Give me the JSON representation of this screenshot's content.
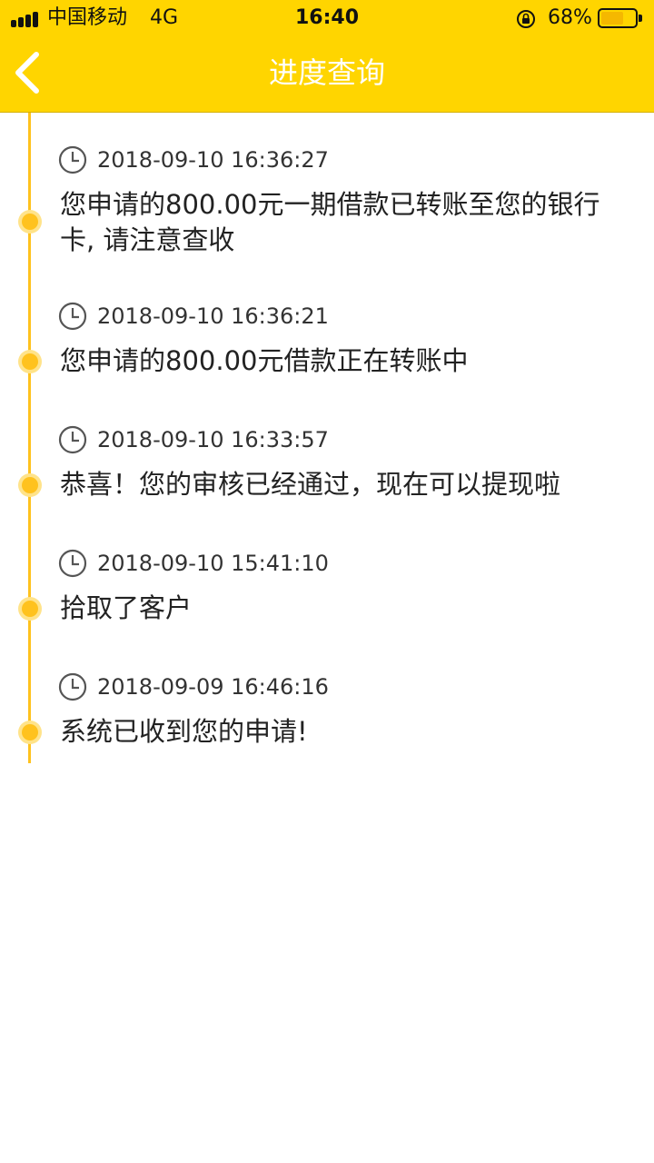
{
  "status_bar": {
    "carrier": "中国移动",
    "network": "4G",
    "time": "16:40",
    "battery": "68%",
    "battery_level": 0.68
  },
  "header": {
    "title": "进度查询",
    "back_icon": "chevron-left-icon"
  },
  "events": [
    {
      "time": "2018-09-10 16:36:27",
      "text": "您申请的800.00元一期借款已转账至您的银行卡, 请注意查收"
    },
    {
      "time": "2018-09-10 16:36:21",
      "text": "您申请的800.00元借款正在转账中"
    },
    {
      "time": "2018-09-10 16:33:57",
      "text": "恭喜！您的审核已经通过，现在可以提现啦"
    },
    {
      "time": "2018-09-10 15:41:10",
      "text": "拾取了客户"
    },
    {
      "time": "2018-09-09 16:46:16",
      "text": "系统已收到您的申请!"
    }
  ],
  "colors": {
    "brand_yellow": "#ffd500",
    "timeline": "#ffc21e",
    "title_text": "#ffffff"
  }
}
